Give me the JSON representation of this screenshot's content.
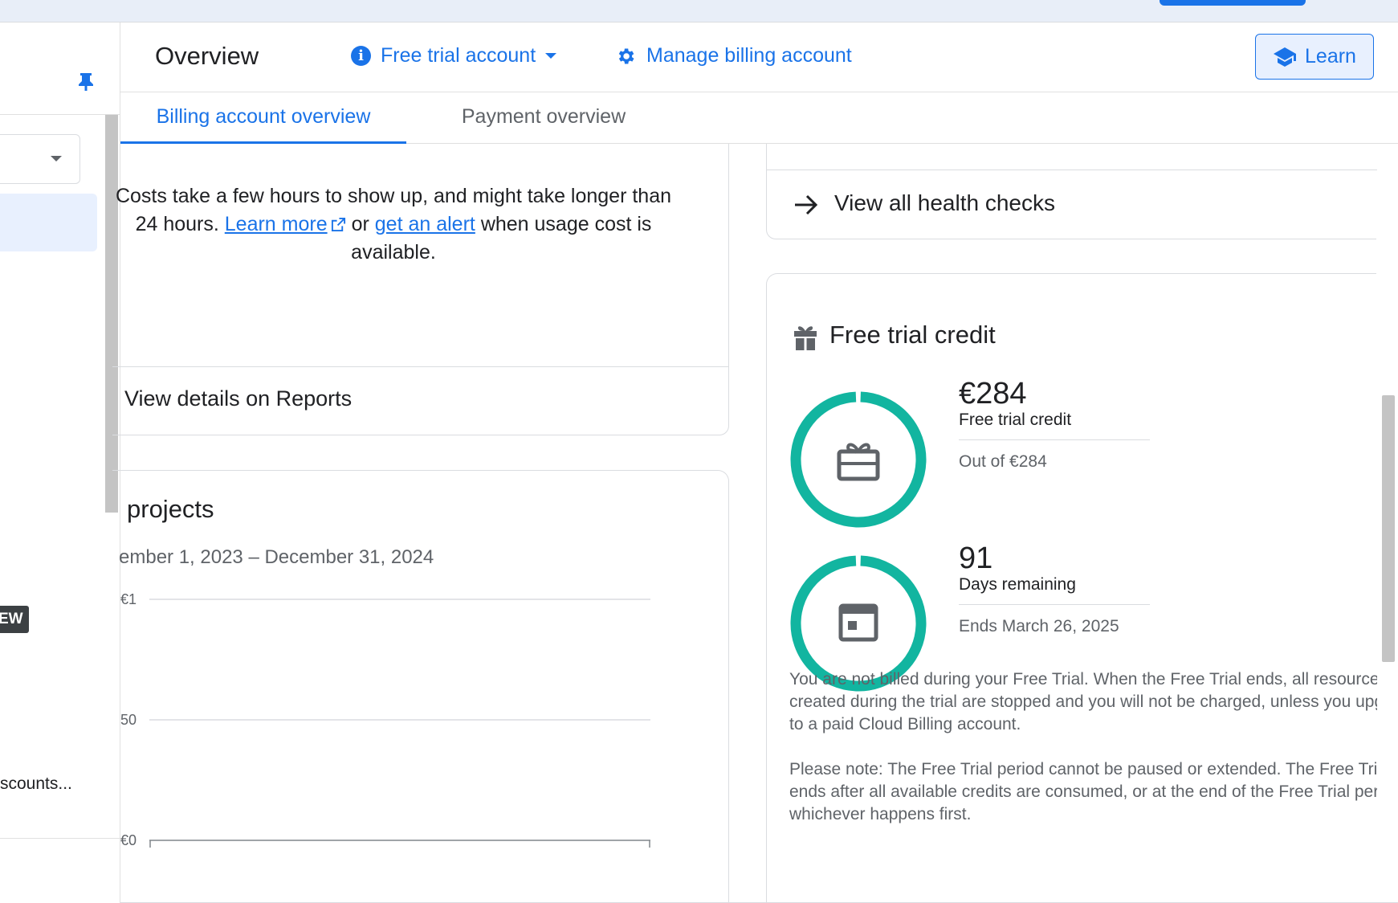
{
  "header": {
    "title": "Overview",
    "trial_menu_label": "Free trial account",
    "manage_label": "Manage billing account",
    "learn_label": "Learn"
  },
  "nav": {
    "new_badge": "EW",
    "accounts_item": "scounts..."
  },
  "tabs": [
    {
      "label": "Billing account overview",
      "active": true
    },
    {
      "label": "Payment overview",
      "active": false
    }
  ],
  "costs": {
    "line1": "Costs take a few hours to show up, and might take longer than",
    "line2_prefix": "24 hours.",
    "learn_more": "Learn more",
    "or": "or",
    "get_alert": "get an alert",
    "line2_suffix": "when usage cost is",
    "line3": "available.",
    "reports_link": "View details on Reports"
  },
  "projects": {
    "title": "projects",
    "date_range": "ember 1, 2023 – December 31, 2024"
  },
  "chart_data": {
    "type": "line",
    "title": "projects",
    "y_ticks": [
      "€1",
      "50",
      "€0"
    ],
    "series": []
  },
  "health": {
    "link": "View all health checks"
  },
  "trial": {
    "title": "Free trial credit",
    "credit_value": "€284",
    "credit_label": "Free trial credit",
    "credit_sub": "Out of €284",
    "credit_fraction": 1.0,
    "days_value": "91",
    "days_label": "Days remaining",
    "days_sub": "Ends March 26, 2025",
    "days_fraction": 1.0,
    "ring_color": "#12b5a0",
    "note1_l1": "You are not billed during your Free Trial. When the Free Trial ends, all resources",
    "note1_l2": "created during the trial are stopped and you will not be charged, unless you upgrade",
    "note1_l3": "to a paid Cloud Billing account.",
    "note2_l1": "Please note: The Free Trial period cannot be paused or extended. The Free Trial",
    "note2_l2": "ends after all available credits are consumed, or at the end of the Free Trial period,",
    "note2_l3": "whichever happens first."
  },
  "colors": {
    "accent": "#1a73e8",
    "ring": "#12b5a0"
  }
}
